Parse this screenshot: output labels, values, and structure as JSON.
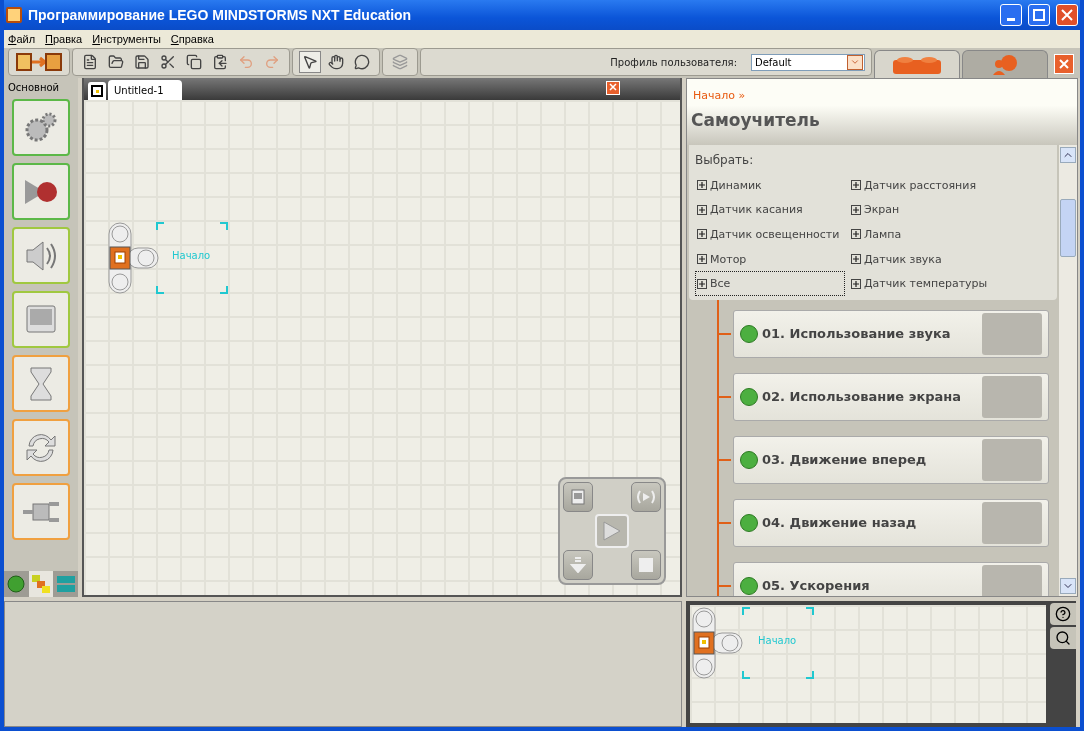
{
  "window": {
    "title": "Программирование LEGO MINDSTORMS NXT Education"
  },
  "menu": [
    "Файл",
    "Правка",
    "Инструменты",
    "Справка"
  ],
  "toolbar": {
    "profile_label": "Профиль пользователя:",
    "profile_value": "Default"
  },
  "palette": {
    "label": "Основной",
    "tabs": [
      {
        "kind": "dot",
        "selected": false
      },
      {
        "kind": "blocks",
        "selected": true
      },
      {
        "kind": "bars",
        "selected": false
      }
    ]
  },
  "document_tab": {
    "title": "Untitled-1"
  },
  "canvas": {
    "start_label": "Начало"
  },
  "side_tabs": [
    {
      "kind": "brick",
      "selected": true
    },
    {
      "kind": "person",
      "selected": false
    }
  ],
  "panel": {
    "breadcrumb": "Начало »",
    "title": "Самоучитель",
    "filter_label": "Выбрать:",
    "filters": [
      {
        "label": "Динамик",
        "selected": false
      },
      {
        "label": "Датчик касания",
        "selected": false
      },
      {
        "label": "Датчик освещенности",
        "selected": false
      },
      {
        "label": "Мотор",
        "selected": false
      },
      {
        "label": "Все",
        "selected": true
      },
      {
        "label": "Датчик расстояния",
        "selected": false
      },
      {
        "label": "Экран",
        "selected": false
      },
      {
        "label": "Лампа",
        "selected": false
      },
      {
        "label": "Датчик звука",
        "selected": false
      },
      {
        "label": "Датчик температуры",
        "selected": false
      }
    ],
    "lessons": [
      "01. Использование звука",
      "02. Использование экрана",
      "03. Движение вперед",
      "04. Движение назад",
      "05. Ускорения"
    ]
  },
  "minimap": {
    "start_label": "Начало"
  }
}
